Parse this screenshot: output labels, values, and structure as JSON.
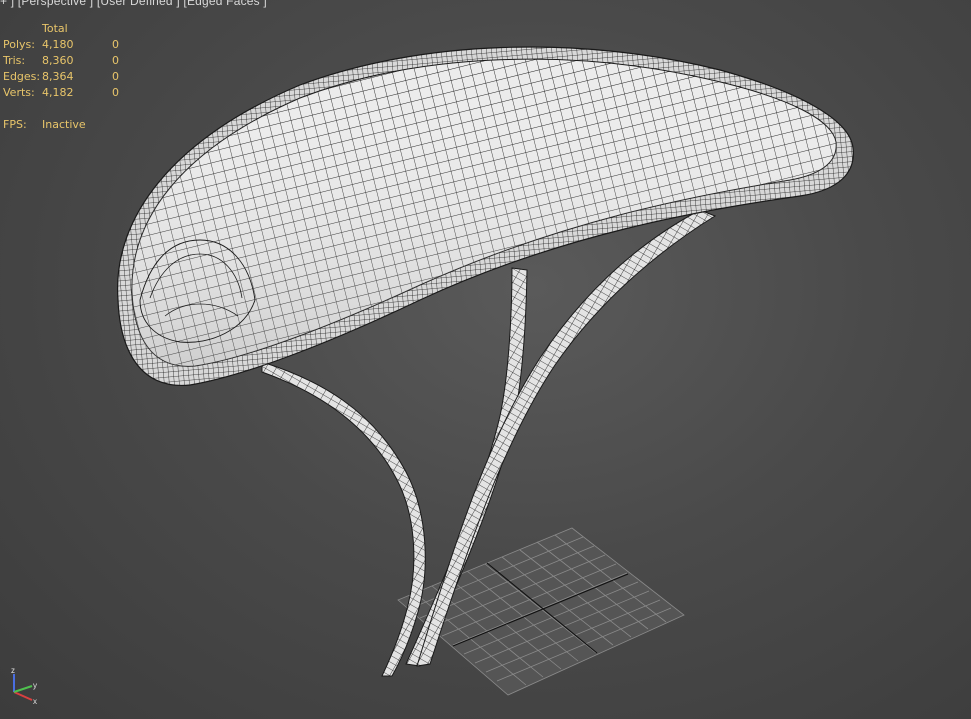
{
  "viewport": {
    "label": "+ ] [Perspective ] [User Defined ] [Edged Faces ]"
  },
  "stats": {
    "header_total": "Total",
    "rows": [
      {
        "label": "Polys:",
        "total": "4,180",
        "selected": "0"
      },
      {
        "label": "Tris:",
        "total": "8,360",
        "selected": "0"
      },
      {
        "label": "Edges:",
        "total": "8,364",
        "selected": "0"
      },
      {
        "label": "Verts:",
        "total": "4,182",
        "selected": "0"
      }
    ],
    "fps_label": "FPS:",
    "fps_value": "Inactive"
  },
  "gizmo": {
    "x_label": "x",
    "y_label": "y",
    "z_label": "z",
    "x_color": "#d94040",
    "y_color": "#4fc04f",
    "z_color": "#4a6ee0"
  },
  "colors": {
    "background": "#4a4a4a",
    "stats_text": "#e8c56a",
    "mesh_fill": "#e9e9e9",
    "mesh_wire": "#1a1a1a",
    "grid": "#8a8a8a",
    "grid_axis": "#111111"
  }
}
